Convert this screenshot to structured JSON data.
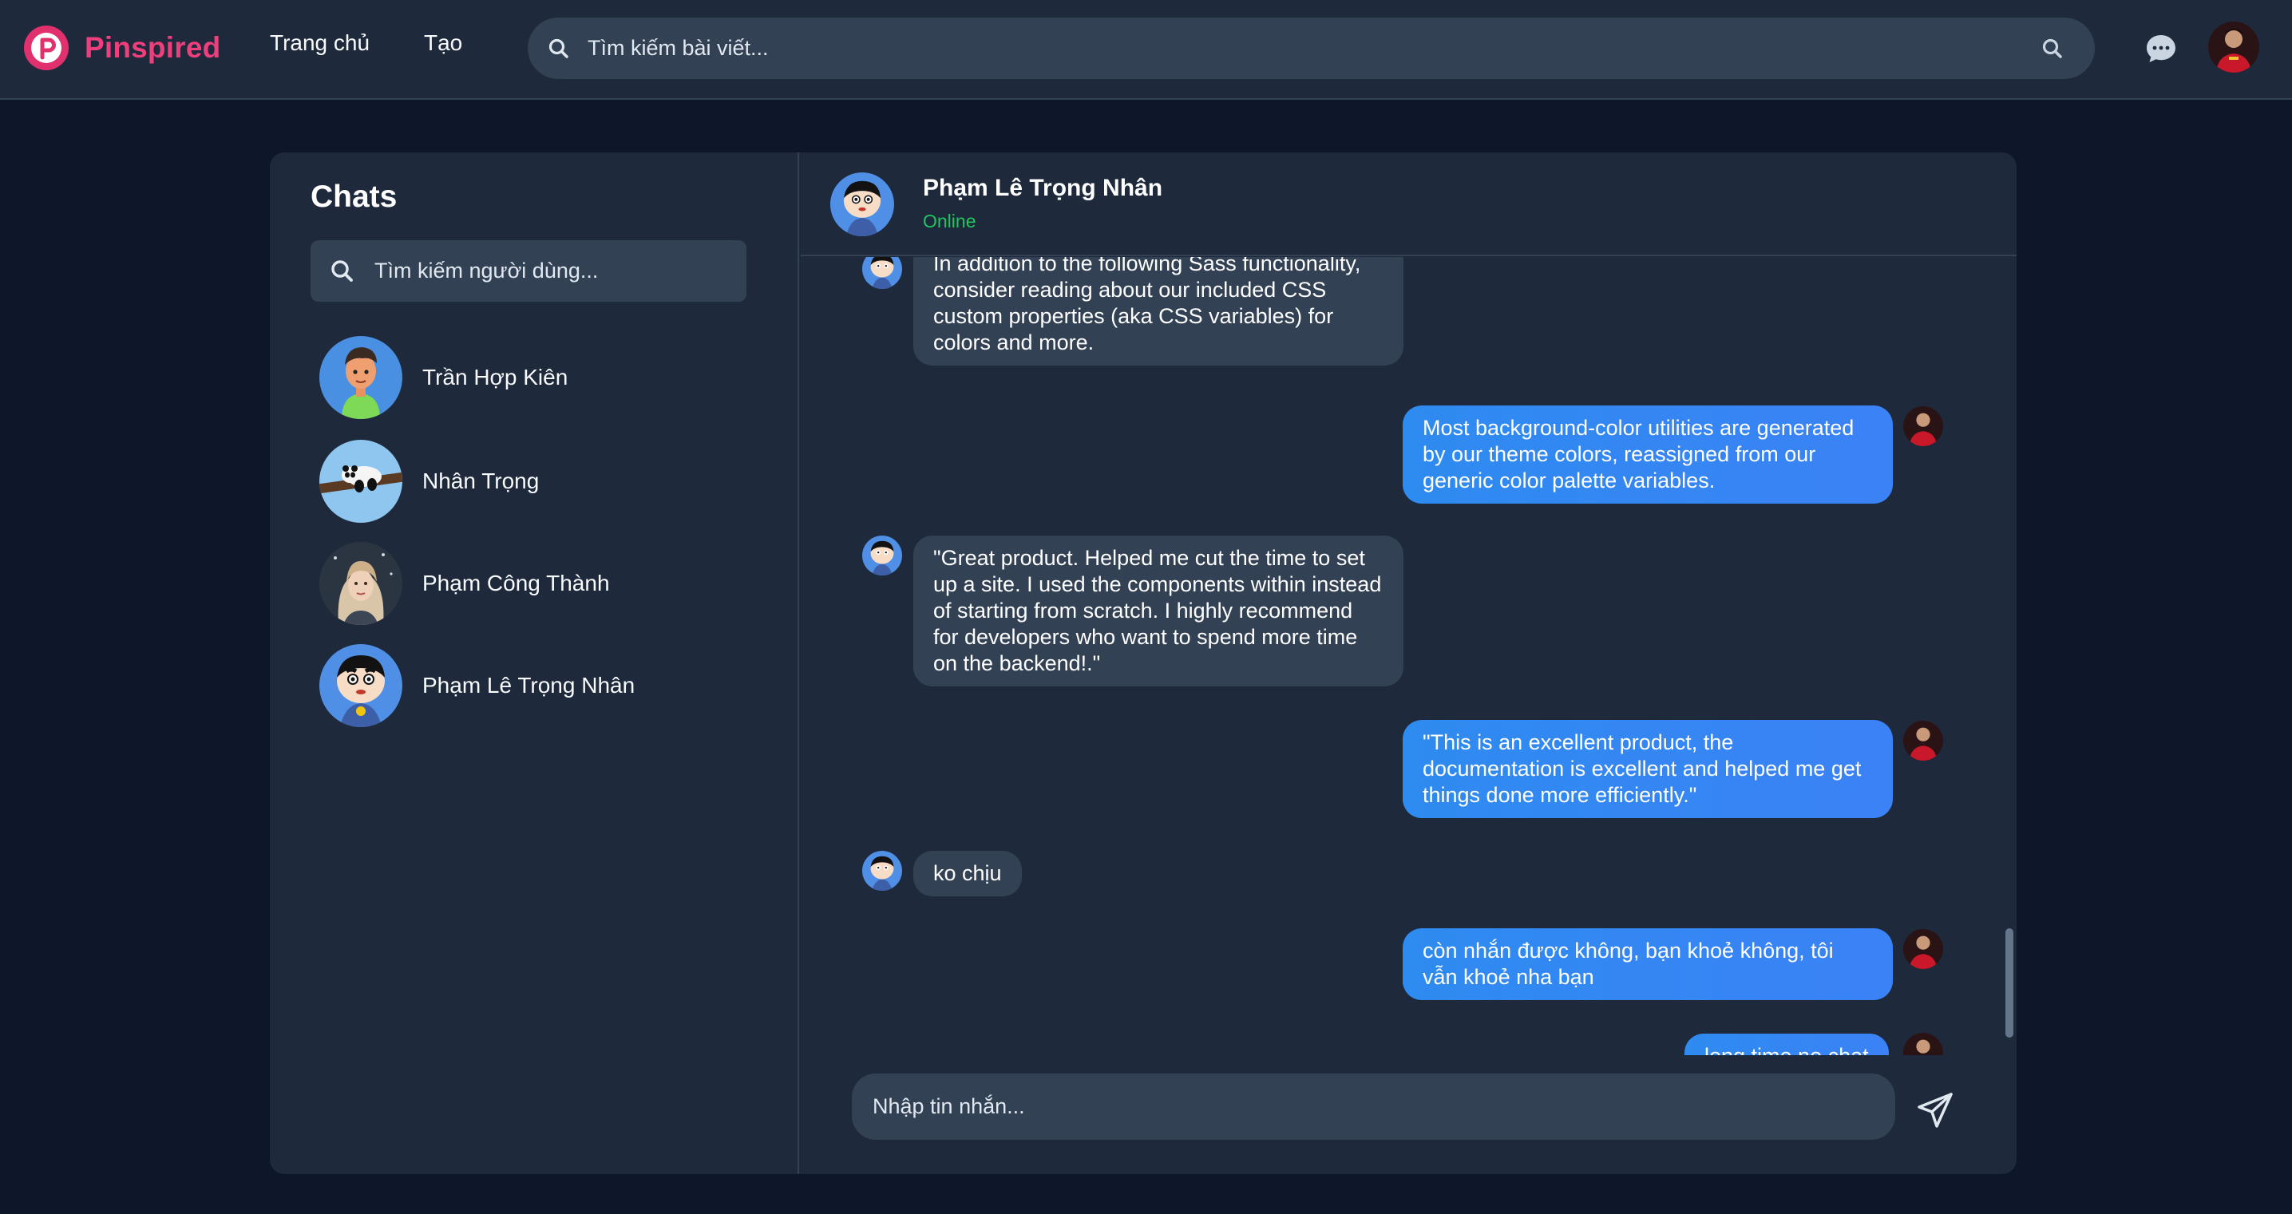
{
  "topbar": {
    "brand_name": "Pinspired",
    "nav": [
      "Trang chủ",
      "Tạo"
    ],
    "search_placeholder": "Tìm kiếm bài viết..."
  },
  "sidebar": {
    "title": "Chats",
    "search_placeholder": "Tìm kiếm người dùng...",
    "contacts": [
      {
        "name": "Trần Hợp Kiên"
      },
      {
        "name": "Nhân Trọng"
      },
      {
        "name": "Phạm Công Thành"
      },
      {
        "name": "Phạm Lê Trọng Nhân"
      }
    ]
  },
  "chat": {
    "contact_name": "Phạm Lê Trọng Nhân",
    "status": "Online",
    "messages": [
      {
        "dir": "in",
        "text": "In addition to the following Sass functionality, consider reading about our included CSS custom properties (aka CSS variables) for colors and more."
      },
      {
        "dir": "out",
        "text": "Most background-color utilities are generated by our theme colors, reassigned from our generic color palette variables."
      },
      {
        "dir": "in",
        "text": "\"Great product. Helped me cut the time to set up a site. I used the components within instead of starting from scratch. I highly recommend for developers who want to spend more time on the backend!.\""
      },
      {
        "dir": "out",
        "text": "\"This is an excellent product, the documentation is excellent and helped me get things done more efficiently.\""
      },
      {
        "dir": "in",
        "text": "ko chịu"
      },
      {
        "dir": "out",
        "text": "còn nhắn được không, bạn khoẻ không, tôi vẫn khoẻ nha bạn"
      },
      {
        "dir": "out",
        "text": "long time no chat"
      }
    ],
    "composer_placeholder": "Nhập tin nhắn..."
  },
  "colors": {
    "brand": "#ec3f7c",
    "bg": "#0e1729",
    "panel": "#1e293b",
    "input": "#334155",
    "outgoing": "#3b82f6",
    "online": "#22c55e"
  }
}
